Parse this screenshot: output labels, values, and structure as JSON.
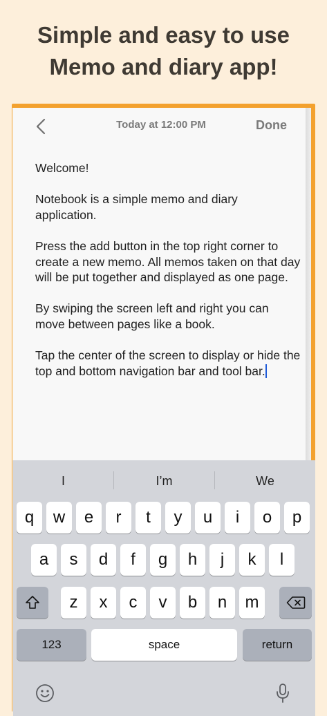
{
  "headline": {
    "line1": "Simple and easy to use",
    "line2": "Memo and diary app!"
  },
  "nav": {
    "back_icon": "chevron-left-icon",
    "title": "Today at 12:00 PM",
    "done_label": "Done"
  },
  "memo": {
    "paragraphs": [
      " Welcome!",
      " Notebook is a simple memo and diary application.",
      " Press the add button in the top right corner to create a new memo. All memos taken on that day will be put together and displayed as one page.",
      " By swiping the screen left and right you can move between pages like a book.",
      " Tap the center of the screen to display or hide the top and bottom navigation bar and tool bar."
    ]
  },
  "keyboard": {
    "suggestions": [
      "I",
      "I’m",
      "We"
    ],
    "row1": [
      "q",
      "w",
      "e",
      "r",
      "t",
      "y",
      "u",
      "i",
      "o",
      "p"
    ],
    "row2": [
      "a",
      "s",
      "d",
      "f",
      "g",
      "h",
      "j",
      "k",
      "l"
    ],
    "row3": [
      "z",
      "x",
      "c",
      "v",
      "b",
      "n",
      "m"
    ],
    "numbers_label": "123",
    "space_label": "space",
    "return_label": "return",
    "icons": {
      "shift": "shift-icon",
      "delete": "delete-icon",
      "emoji": "emoji-icon",
      "mic": "microphone-icon"
    }
  },
  "colors": {
    "background": "#fdefdb",
    "accent": "#f3a12e",
    "caret": "#1f5bd8"
  }
}
